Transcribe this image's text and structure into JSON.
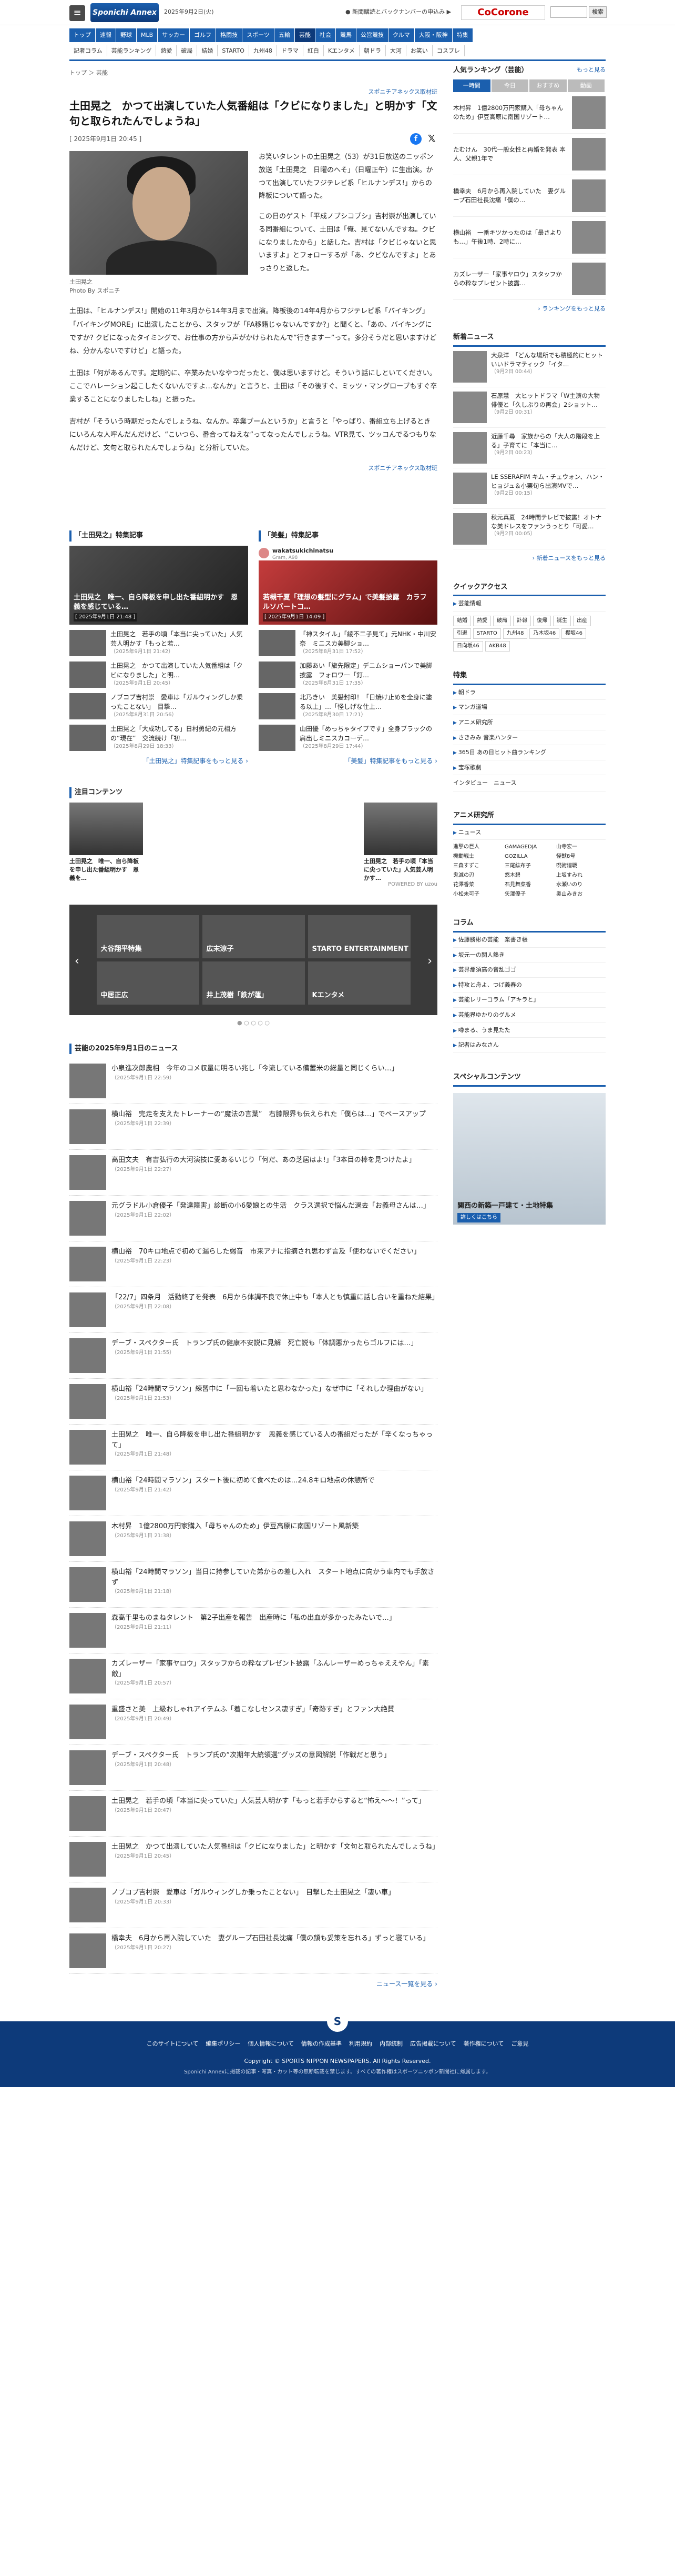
{
  "header": {
    "menu": "≡",
    "logo": "Sponichi Annex",
    "date": "2025年9月2日(火)",
    "notice": "● 新聞購読とバックナンバーの申込み ▶",
    "cocorone": "CoCorone",
    "search_placeholder": "",
    "search_btn": "検索"
  },
  "gnav": {
    "main": [
      "トップ",
      "速報",
      "野球",
      "MLB",
      "サッカー",
      "ゴルフ",
      "格闘技",
      "スポーツ",
      "五輪",
      "芸能",
      "社会",
      "競馬",
      "公営競技",
      "クルマ",
      "大阪・阪神",
      "特集"
    ],
    "active": "芸能",
    "sub": [
      "記者コラム",
      "芸能ランキング",
      "熱愛",
      "破局",
      "結婚",
      "STARTO",
      "九州48",
      "ドラマ",
      "紅白",
      "Kエンタメ",
      "朝ドラ",
      "大河",
      "お笑い",
      "コスプレ"
    ]
  },
  "crumb": "トップ ＞ 芸能",
  "article": {
    "source_top": "スポニチアネックス取材班",
    "title": "土田晃之　かつて出演していた人気番組は「クビになりました」と明かす「文句と取られたんでしょうね」",
    "timestamp": "[ 2025年9月1日 20:45 ]",
    "caption": "土田晃之",
    "credit": "Photo By スポニチ",
    "lead": [
      "お笑いタレントの土田晃之（53）が31日放送のニッポン放送「土田晃之　日曜のへそ」（日曜正午）に生出演。かつて出演していたフジテレビ系「ヒルナンデス!」からの降板について語った。",
      "この日のゲスト「平成ノブシコブシ」吉村崇が出演している同番組について、土田は「俺、見てないんですね。クビになりましたから」と話した。吉村は「クビじゃないと思いますよ」とフォローするが「あ、クビなんですよ」とあっさりと返した。"
    ],
    "body": [
      "土田は、「ヒルナンデス!」開始の11年3月から14年3月まで出演。降板後の14年4月からフジテレビ系「バイキング」「バイキングMORE」に出演したことから、スタッフが「FA移籍じゃないんですか?」と聞くと、「あの、バイキングにですか? クビになったタイミングで、お仕事の方から声がかけられたんで”行きますー”って。多分そうだと思いますけどね、分かんないですけど」と語った。",
      "土田は「何があるんです。定期的に、卒業みたいなやつだったと、僕は思いますけど。そういう話にしといてください。ここでハレーション起こしたくないんですよ…なんか」と言うと、土田は「その後すぐ、ミッツ・マングローブもすぐ卒業することになりましたしね」と振った。",
      "吉村が「そういう時期だったんでしょうね、なんか。卒業ブームというか」と言うと「やっぱり、番組立ち上げるときにいろんな人呼んだんだけど、“こいつら、番合ってねえな”ってなったんでしょうね。VTR見て、ツッコんでるつもりなんだけど、文句と取られたんでしょうね」と分析していた。"
    ],
    "source_bottom": "スポニチアネックス取材班"
  },
  "related": {
    "left": {
      "heading": "「土田晃之」特集記事",
      "hero_title": "土田晃之　唯一、自ら降板を申し出た番組明かす　恩義を感じている…",
      "hero_date": "[ 2025年9月1日 21:48 ]",
      "items": [
        {
          "t": "土田晃之　若手の頃「本当に尖っていた」人気芸人明かす「もっと若…",
          "d": "（2025年9月1日 21:42）"
        },
        {
          "t": "土田晃之　かつて出演していた人気番組は「クビになりました」と明…",
          "d": "（2025年9月1日 20:45）"
        },
        {
          "t": "ノブコブ吉村崇　愛車は「ガルウィングしか乗ったことない」　目撃…",
          "d": "（2025年8月31日 20:56）"
        },
        {
          "t": "土田晃之「大成功してる」日村勇紀の元相方の“現在”　交流続け「初…",
          "d": "（2025年8月29日 18:33）"
        }
      ],
      "more": "「土田晃之」特集記事をもっと見る ›"
    },
    "right": {
      "heading": "「美髪」特集記事",
      "insta_user": "wakatsukichinatsu",
      "insta_sub": "Gram, A98",
      "hero_title": "若槻千夏「理想の髪型にグラム」で美髪披露　カラフルソバートコ…",
      "hero_date": "[ 2025年9月1日 14:09 ]",
      "items": [
        {
          "t": "「神スタイル」「綾不二子見て」元NHK・中川安奈　ミニスカ美脚ショ…",
          "d": "（2025年8月31日 17:52）"
        },
        {
          "t": "加藤あい「旅先限定」デニムショーパンで美脚披露　フォロワー「釘…",
          "d": "（2025年8月31日 17:35）"
        },
        {
          "t": "北乃きい　美髪封印！「日焼け止めを全身に塗る以上」…「怪しげな仕上…",
          "d": "（2025年8月30日 17:21）"
        },
        {
          "t": "山田優「めっちゃタイプです」全身ブラックの肩出しミニスカコーデ…",
          "d": "（2025年8月29日 17:44）"
        }
      ],
      "more": "「美髪」特集記事をもっと見る ›"
    }
  },
  "hot": {
    "heading": "注目コンテンツ",
    "left": "土田晃之　唯一、自ら降板を申し出た番組明かす　恩義を…",
    "right": "土田晃之　若手の頃「本当に尖っていた」人気芸人明かす…",
    "pr": "POWERED BY uzou"
  },
  "slider": {
    "cells": [
      "大谷翔平特集",
      "広末涼子",
      "STARTO ENTERTAINMENT",
      "中居正広",
      "井上茂樹「鉄が蓮」",
      "Kエンタメ"
    ],
    "dots": "● ○ ○ ○ ○"
  },
  "news": {
    "heading": "芸能の2025年9月1日のニュース",
    "items": [
      {
        "t": "小泉進次郎農相　今年のコメ収量に明るい兆し「今流している備蓄米の総量と同じくらい…」",
        "d": "（2025年9月1日 22:59）"
      },
      {
        "t": "横山裕　完走を支えたトレーナーの“魔法の言葉”　右膝限界も伝えられた「僕らは…」でペースアップ",
        "d": "（2025年9月1日 22:39）"
      },
      {
        "t": "高田文夫　有吉弘行の大河演技に愛あるいじり「何だ、あの芝居はよ!」「3本目の棒を見つけたよ」",
        "d": "（2025年9月1日 22:27）"
      },
      {
        "t": "元グラドル小倉優子「発達障害」診断の小6愛娘との生活　クラス選択で悩んだ過去「お義母さんは…」",
        "d": "（2025年9月1日 22:02）"
      },
      {
        "t": "横山裕　70キロ地点で初めて漏らした弱音　市来アナに指摘され思わず言及「使わないでください」",
        "d": "（2025年9月1日 22:23）"
      },
      {
        "t": "「22/7」四条月　活動終了を発表　6月から体調不良で休止中も「本人とも慎重に話し合いを重ねた結果」",
        "d": "（2025年9月1日 22:08）"
      },
      {
        "t": "デーブ・スペクター氏　トランプ氏の健康不安説に見解　死亡説も「体調悪かったらゴルフには…」",
        "d": "（2025年9月1日 21:55）"
      },
      {
        "t": "横山裕「24時間マラソン」練習中に「一回も着いたと思わなかった」なぜ中に「それしか理由がない」",
        "d": "（2025年9月1日 21:53）"
      },
      {
        "t": "土田晃之　唯一、自ら降板を申し出た番組明かす　恩義を感じている人の番組だったが「辛くなっちゃって」",
        "d": "（2025年9月1日 21:48）"
      },
      {
        "t": "横山裕「24時間マラソン」スタート後に初めて食べたのは…24.8キロ地点の休憩所で",
        "d": "（2025年9月1日 21:42）"
      },
      {
        "t": "木村昇　1億2800万円家購入「母ちゃんのため」伊豆高原に南国リゾート風新築",
        "d": "（2025年9月1日 21:38）"
      },
      {
        "t": "横山裕「24時間マラソン」当日に持参していた弟からの差し入れ　スタート地点に向かう車内でも手放さず",
        "d": "（2025年9月1日 21:18）"
      },
      {
        "t": "森高千里ものまねタレント　第2子出産を報告　出産時に「私の出血が多かったみたいで…」",
        "d": "（2025年9月1日 21:11）"
      },
      {
        "t": "カズレーザー「家事ヤロウ」スタッフからの粋なプレゼント披露「ふんレーザーめっちゃええやん」「素敵」",
        "d": "（2025年9月1日 20:57）"
      },
      {
        "t": "重盛さと美　上級おしゃれアイテムふ「着こなしセンス凄すぎ」「奇跡すぎ」とファン大絶賛",
        "d": "（2025年9月1日 20:49）"
      },
      {
        "t": "デーブ・スペクター氏　トランプ氏の“次期年大統領選”グッズの意図解説「作戦だと思う」",
        "d": "（2025年9月1日 20:48）"
      },
      {
        "t": "土田晃之　若手の頃「本当に尖っていた」人気芸人明かす「もっと若手からすると“怖え〜〜！”って」",
        "d": "（2025年9月1日 20:47）"
      },
      {
        "t": "土田晃之　かつて出演していた人気番組は「クビになりました」と明かす「文句と取られたんでしょうね」",
        "d": "（2025年9月1日 20:45）"
      },
      {
        "t": "ノブコブ吉村崇　愛車は「ガルウィングしか乗ったことない」　目撃した土田晃之「凄い車」",
        "d": "（2025年9月1日 20:33）"
      },
      {
        "t": "橋幸夫　6月から再入院していた　妻グループ石田社長沈痛「僕の顔も妥策を忘れる」ずっと寝ている」",
        "d": "（2025年9月1日 20:27）"
      }
    ],
    "more": "ニュース一覧を見る ›"
  },
  "side": {
    "rank_heading": "人気ランキング（芸能）",
    "rank_more": "もっと見る",
    "rank_tabs": [
      "一時間",
      "今日",
      "おすすめ",
      "動画"
    ],
    "ranks": [
      "木村昇　1億2800万円家購入「母ちゃんのため」伊豆高原に南国リゾート…",
      "たむけん　30代一般女性と再婚を発表 本人、父親1年で",
      "橋幸夫　6月から再入院していた　妻グループ石田社長沈痛「僕の…",
      "横山裕　一番キツかったのは「最さよりも…」午後1時、2時に…",
      "カズレーザー「家事ヤロウ」スタッフからの粋なプレゼント披露…"
    ],
    "ranks_more": "› ランキングをもっと見る",
    "new_heading": "新着ニュース",
    "new_items": [
      {
        "t": "大泉洋　「どんな場所でも積極的にヒットいいドラマティック「イタ…",
        "d": "（9月2日 00:44）"
      },
      {
        "t": "石原慧　大ヒットドラマ「W主演の大物俳優と「久しぶりの再会」2ショット…",
        "d": "（9月2日 00:31）"
      },
      {
        "t": "近藤千尋　家族からの「大人の階段を上る」子育てに「本当に…",
        "d": "（9月2日 00:23）"
      },
      {
        "t": "LE SSERAFIM キム・チェウォン、ハン・ヒョジュ＆小栗旬ら出演MVで…",
        "d": "（9月2日 00:15）"
      },
      {
        "t": "秋元真夏　24時間テレビで披露！オトナな美ドレスをファンうっとり「可愛…",
        "d": "（9月2日 00:05）"
      }
    ],
    "new_more": "› 新着ニュースをもっと見る",
    "quick_heading": "クイックアクセス",
    "quick_link": "芸能情報",
    "quick_tags": [
      "結婚",
      "熱愛",
      "破局",
      "訃報",
      "復帰",
      "誕生",
      "出産",
      "引退",
      "STARTO",
      "九州48",
      "乃木坂46",
      "櫻坂46",
      "日向坂46",
      "AKB48"
    ],
    "feature_heading": "特集",
    "features": [
      "朝ドラ",
      "マンガ道場",
      "アニメ研究所",
      "さきみみ 音楽ハンター",
      "365日 あの日ヒット曲ランキング",
      "宝塚歌劇"
    ],
    "interview": "インタビュー　ニュース",
    "anime_heading": "アニメ研究所",
    "anime_news": "ニュース",
    "anime_tags": [
      "進撃の巨人",
      "GAMAGEDJA",
      "山寺宏一",
      "機動戦士",
      "GOZILLA",
      "怪獣8号",
      "三森すずこ",
      "三尾紘布子",
      "呪術廻戦",
      "鬼滅の刃",
      "悠木碧",
      "上坂すみれ",
      "花澤香菜",
      "石見舞菜香",
      "水瀬いのり",
      "小松未可子",
      "矢澤優子",
      "奥山みきお"
    ],
    "column_heading": "コラム",
    "columns": [
      "佐藤勝彬の芸能　楽書き帳",
      "坂元一の関人熱き",
      "芸界那須高の音乱ゴゴ",
      "特攻と舟よ、つげ義春の",
      "芸能レリーコラム「アキラと」",
      "芸能界ゆかりのグルメ",
      "噂まる、うま見たた",
      "記者はみなさん"
    ],
    "special_heading": "スペシャルコンテンツ",
    "ad_title": "関西の新築一戸建て・土地特集",
    "ad_badge": "詳しくはこちら"
  },
  "footer": {
    "logo": "S",
    "links": [
      "このサイトについて",
      "編集ポリシー",
      "個人情報について",
      "情報の作成基準",
      "利用規約",
      "内部統制",
      "広告掲載について",
      "著作権について",
      "ご意見"
    ],
    "copyright": "Copyright © SPORTS NIPPON NEWSPAPERS. All Rights Reserved.",
    "note": "Sponichi Annexに掲載の記事・写真・カット等の無断転載を禁じます。すべての著作権はスポーツニッポン新聞社に帰属します。"
  }
}
